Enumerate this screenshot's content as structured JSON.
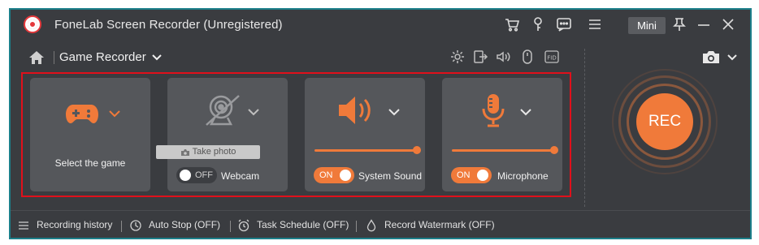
{
  "app": {
    "title": "FoneLab Screen Recorder (Unregistered)"
  },
  "titlebar": {
    "mini_label": "Mini"
  },
  "toolbar": {
    "mode_title": "Game Recorder"
  },
  "cards": {
    "game": {
      "label": "Select the game"
    },
    "webcam": {
      "take_photo_label": "Take photo",
      "toggle_state": "OFF",
      "label": "Webcam"
    },
    "system_sound": {
      "toggle_state": "ON",
      "label": "System Sound",
      "volume": 0.95
    },
    "microphone": {
      "toggle_state": "ON",
      "label": "Microphone",
      "volume": 0.95
    }
  },
  "record": {
    "label": "REC"
  },
  "statusbar": {
    "recording_history": "Recording history",
    "auto_stop": "Auto Stop (OFF)",
    "task_schedule": "Task Schedule (OFF)",
    "record_watermark": "Record Watermark (OFF)"
  },
  "colors": {
    "accent": "#f07a3a",
    "window_bg": "#3a3c40",
    "card_bg": "#55575b",
    "highlight": "#e0101b"
  },
  "icons": [
    "app-logo-icon",
    "cart-icon",
    "key-icon",
    "chat-icon",
    "menu-icon",
    "pin-icon",
    "minimize-icon",
    "close-icon",
    "home-icon",
    "chevron-down-icon",
    "settings-icon",
    "export-icon",
    "volume-icon",
    "mouse-icon",
    "fid-icon",
    "camera-icon",
    "gamepad-icon",
    "webcam-icon",
    "speaker-icon",
    "microphone-icon",
    "list-icon",
    "clock-icon",
    "alarm-icon",
    "drop-icon"
  ]
}
